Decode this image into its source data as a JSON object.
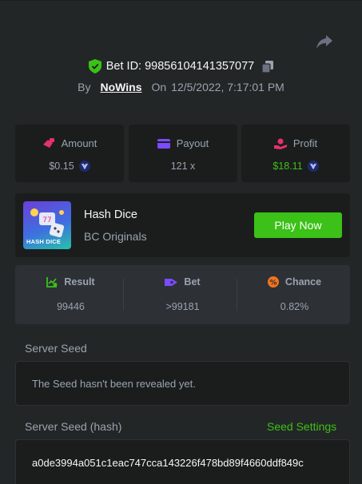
{
  "header": {
    "bet_id": "Bet ID: 99856104141357077",
    "by_label": "By",
    "username": "NoWins",
    "on_label": "On",
    "date": "12/5/2022, 7:17:01 PM"
  },
  "stats": {
    "amount": {
      "label": "Amount",
      "value": "$0.15"
    },
    "payout": {
      "label": "Payout",
      "value": "121 x"
    },
    "profit": {
      "label": "Profit",
      "value": "$18.11"
    }
  },
  "game": {
    "title": "Hash Dice",
    "provider": "BC Originals",
    "thumb_text": "HASH DICE",
    "play_label": "Play Now"
  },
  "result": {
    "result": {
      "label": "Result",
      "value": "99446"
    },
    "bet": {
      "label": "Bet",
      "value": ">99181"
    },
    "chance": {
      "label": "Chance",
      "value": "0.82%"
    }
  },
  "server_seed": {
    "label": "Server Seed",
    "value": "The Seed hasn't been revealed yet."
  },
  "server_seed_hash": {
    "label": "Server Seed (hash)",
    "settings_label": "Seed Settings",
    "value": "a0de3994a051c1eac747cca143226f478bd89f4660ddf849c"
  },
  "colors": {
    "background": "#232626",
    "card": "#1b1d1d",
    "accent_green": "#3bc117",
    "muted_text": "#99a4b0"
  },
  "icons": [
    "share-icon",
    "verified-shield-icon",
    "copy-icon",
    "amount-icon",
    "payout-icon",
    "profit-icon",
    "coin-icon",
    "result-icon",
    "bet-tag-icon",
    "chance-icon"
  ]
}
